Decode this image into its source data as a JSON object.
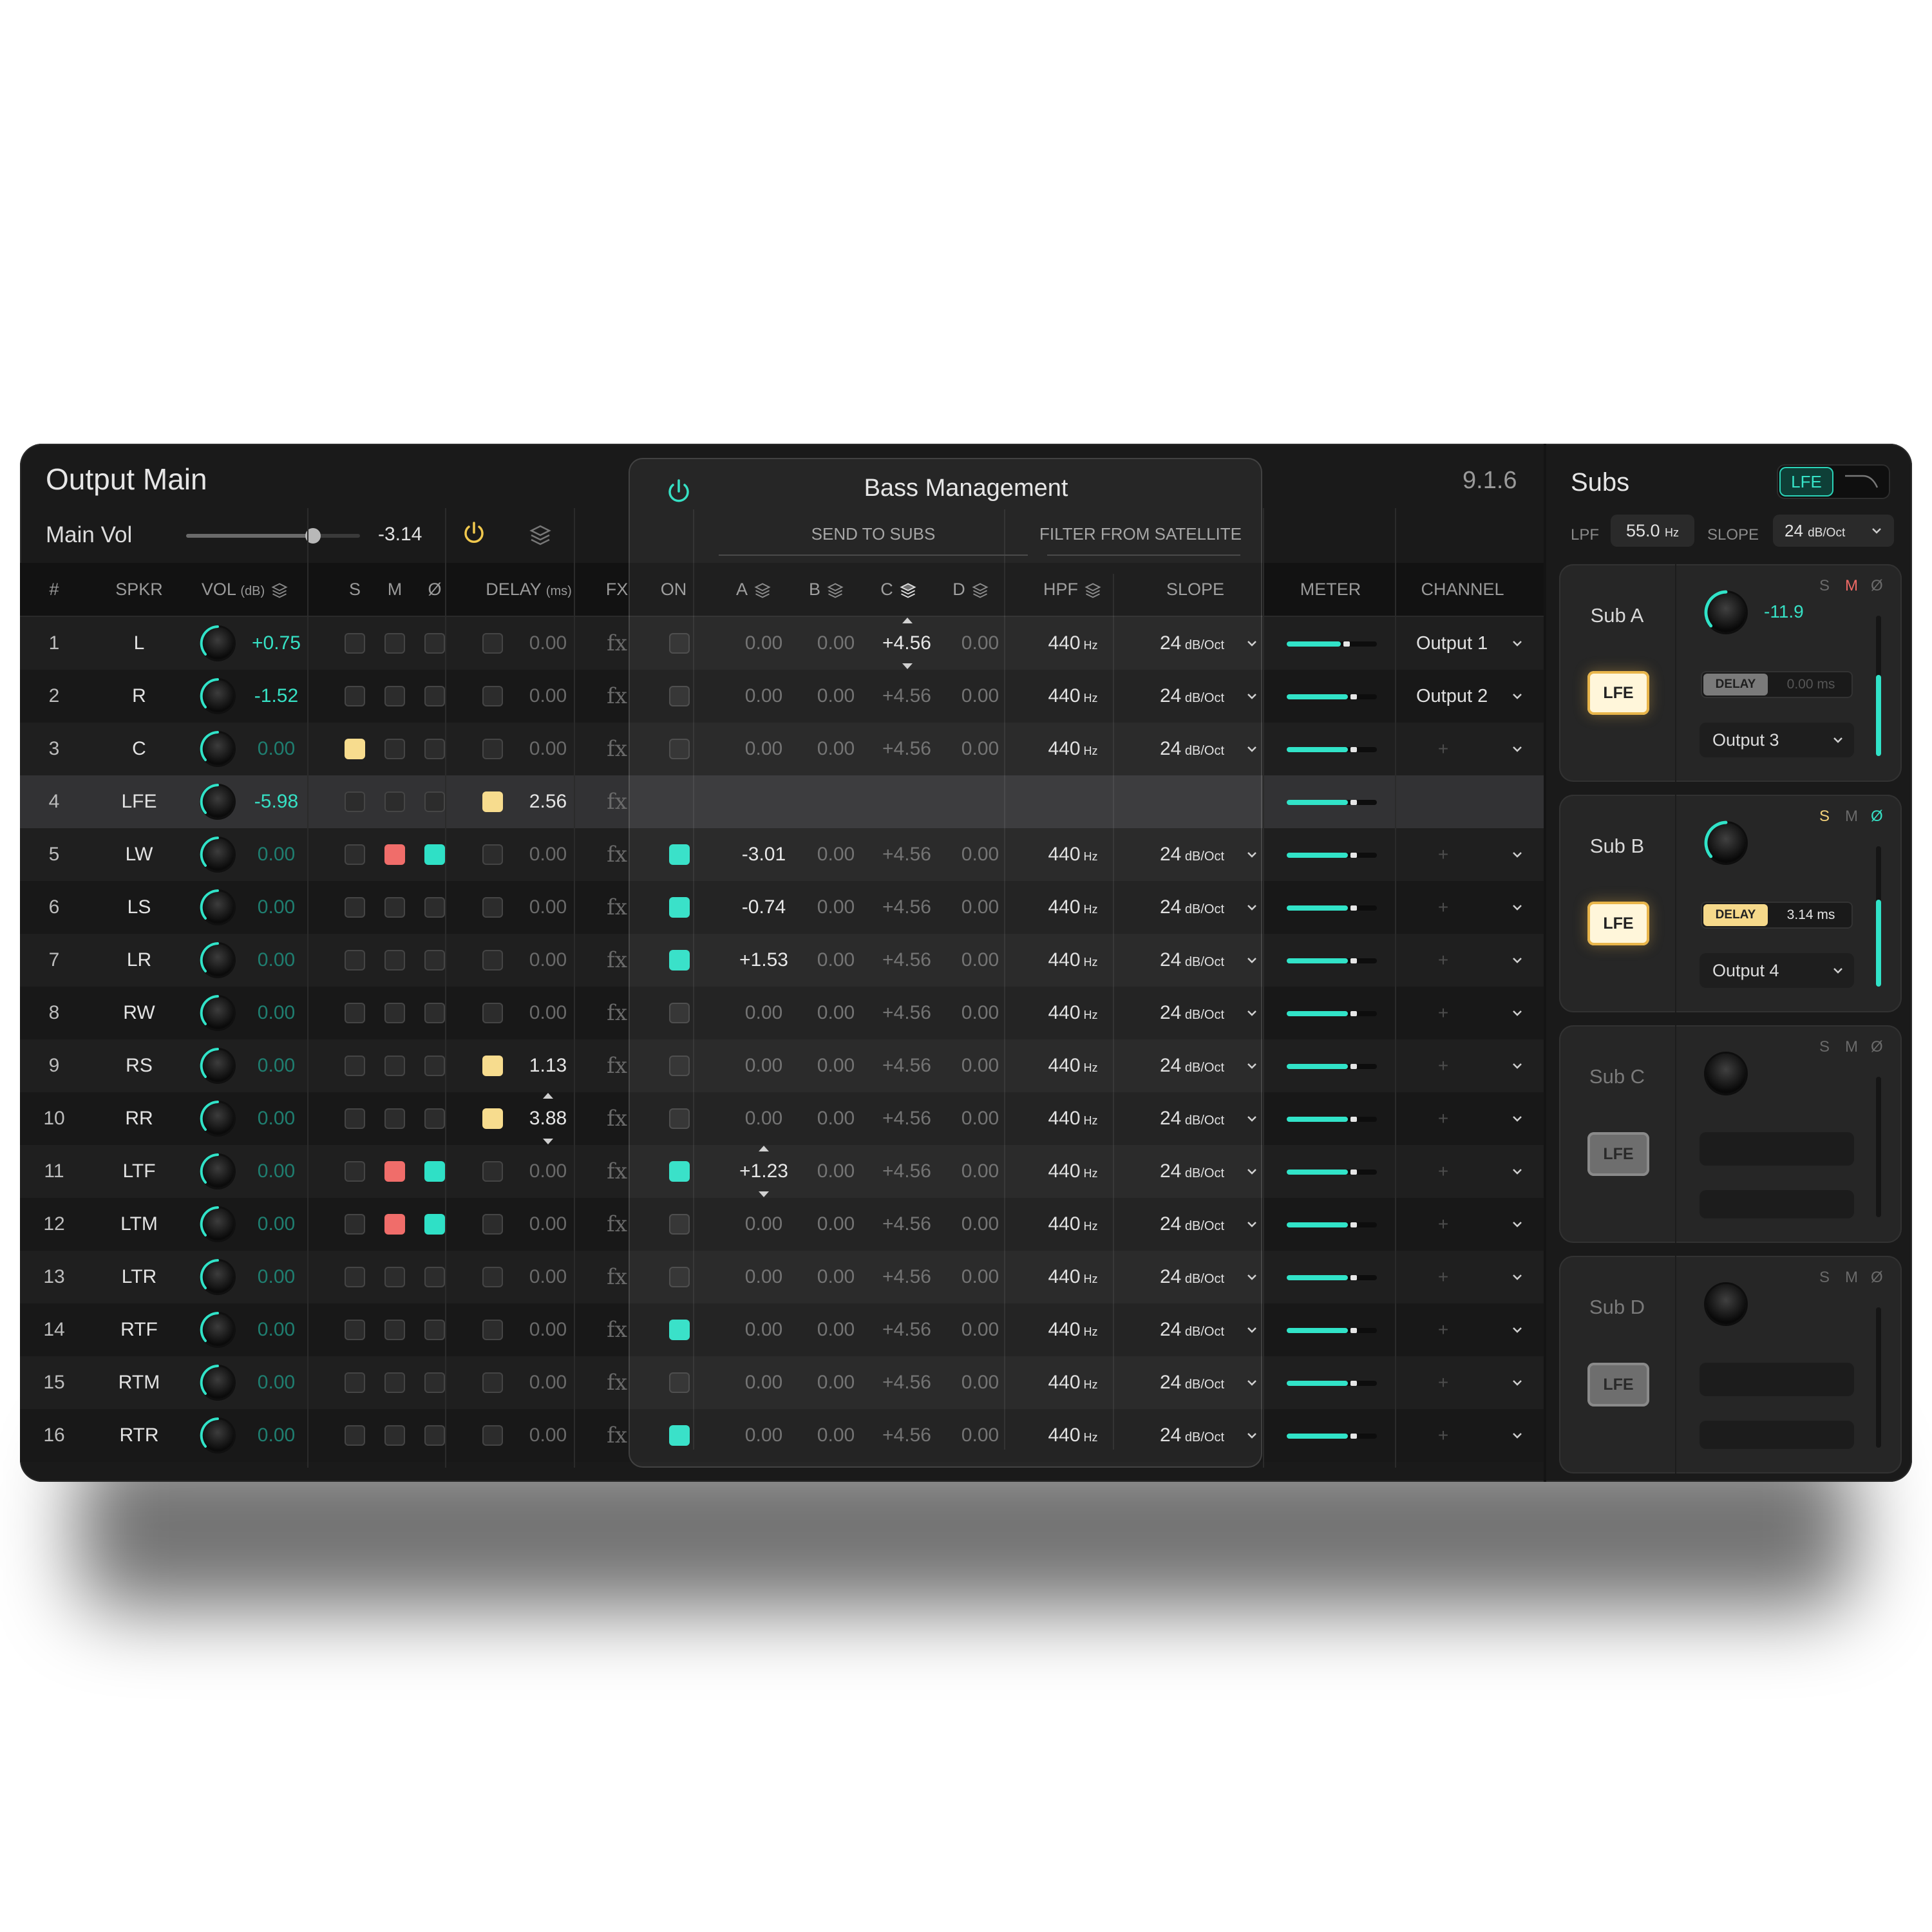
{
  "title": "Output Main",
  "main_vol": {
    "label": "Main Vol",
    "value": "-3.14",
    "slider_level": 0.73
  },
  "format": "9.1.6",
  "headers": {
    "num": "#",
    "spkr": "SPKR",
    "vol": "VOL",
    "vol_unit": "(dB)",
    "s": "S",
    "m": "M",
    "phase": "Ø",
    "delay": "DELAY",
    "delay_unit": "(ms)",
    "fx": "FX",
    "on": "ON",
    "a": "A",
    "b": "B",
    "c": "C",
    "d": "D",
    "hpf": "HPF",
    "slope": "SLOPE",
    "meter": "METER",
    "channel": "CHANNEL"
  },
  "bass_management": {
    "title": "Bass Management",
    "send_to_subs": "SEND TO SUBS",
    "filter_from_satellite": "FILTER FROM SATELLITE"
  },
  "units": {
    "hz": "Hz",
    "db_oct": "dB/Oct"
  },
  "rows": [
    {
      "num": "1",
      "spkr": "L",
      "vol": "+0.75",
      "s": "off",
      "m": "off",
      "p": "off",
      "delay_on": false,
      "delay": "0.00",
      "fx": "fx",
      "on": false,
      "a": "0.00",
      "b": "0.00",
      "c": "+4.56",
      "d": "0.00",
      "hpf": "440",
      "slope": "24",
      "meter": 0.6,
      "channel": "Output 1"
    },
    {
      "num": "2",
      "spkr": "R",
      "vol": "-1.52",
      "s": "off",
      "m": "off",
      "p": "off",
      "delay_on": false,
      "delay": "0.00",
      "fx": "fx",
      "on": false,
      "a": "0.00",
      "b": "0.00",
      "c": "+4.56",
      "d": "0.00",
      "hpf": "440",
      "slope": "24",
      "meter": 0.68,
      "channel": "Output 2"
    },
    {
      "num": "3",
      "spkr": "C",
      "vol": "0.00",
      "s": "yellow",
      "m": "off",
      "p": "off",
      "delay_on": false,
      "delay": "0.00",
      "fx": "fx",
      "on": false,
      "a": "0.00",
      "b": "0.00",
      "c": "+4.56",
      "d": "0.00",
      "hpf": "440",
      "slope": "24",
      "meter": 0.68,
      "channel": "+"
    },
    {
      "num": "4",
      "spkr": "LFE",
      "vol": "-5.98",
      "s": "off",
      "m": "off",
      "p": "off",
      "delay_on": true,
      "delay": "2.56",
      "fx": "fx",
      "lfe": true,
      "meter": 0.68
    },
    {
      "num": "5",
      "spkr": "LW",
      "vol": "0.00",
      "s": "off",
      "m": "red",
      "p": "teal",
      "delay_on": false,
      "delay": "0.00",
      "fx": "fx",
      "on": true,
      "a": "-3.01",
      "b": "0.00",
      "c": "+4.56",
      "d": "0.00",
      "hpf": "440",
      "slope": "24",
      "meter": 0.68,
      "channel": "+"
    },
    {
      "num": "6",
      "spkr": "LS",
      "vol": "0.00",
      "s": "off",
      "m": "off",
      "p": "off",
      "delay_on": false,
      "delay": "0.00",
      "fx": "fx",
      "on": true,
      "a": "-0.74",
      "b": "0.00",
      "c": "+4.56",
      "d": "0.00",
      "hpf": "440",
      "slope": "24",
      "meter": 0.68,
      "channel": "+"
    },
    {
      "num": "7",
      "spkr": "LR",
      "vol": "0.00",
      "s": "off",
      "m": "off",
      "p": "off",
      "delay_on": false,
      "delay": "0.00",
      "fx": "fx",
      "on": true,
      "a": "+1.53",
      "b": "0.00",
      "c": "+4.56",
      "d": "0.00",
      "hpf": "440",
      "slope": "24",
      "meter": 0.68,
      "channel": "+"
    },
    {
      "num": "8",
      "spkr": "RW",
      "vol": "0.00",
      "s": "off",
      "m": "off",
      "p": "off",
      "delay_on": false,
      "delay": "0.00",
      "fx": "fx",
      "on": false,
      "a": "0.00",
      "b": "0.00",
      "c": "+4.56",
      "d": "0.00",
      "hpf": "440",
      "slope": "24",
      "meter": 0.68,
      "channel": "+"
    },
    {
      "num": "9",
      "spkr": "RS",
      "vol": "0.00",
      "s": "off",
      "m": "off",
      "p": "off",
      "delay_on": true,
      "delay": "1.13",
      "fx": "fx",
      "on": false,
      "a": "0.00",
      "b": "0.00",
      "c": "+4.56",
      "d": "0.00",
      "hpf": "440",
      "slope": "24",
      "meter": 0.68,
      "channel": "+"
    },
    {
      "num": "10",
      "spkr": "RR",
      "vol": "0.00",
      "s": "off",
      "m": "off",
      "p": "off",
      "delay_on": true,
      "delay": "3.88",
      "fx": "fx",
      "on": false,
      "a": "0.00",
      "b": "0.00",
      "c": "+4.56",
      "d": "0.00",
      "hpf": "440",
      "slope": "24",
      "meter": 0.68,
      "channel": "+"
    },
    {
      "num": "11",
      "spkr": "LTF",
      "vol": "0.00",
      "s": "off",
      "m": "red",
      "p": "teal",
      "delay_on": false,
      "delay": "0.00",
      "fx": "fx",
      "on": true,
      "a": "+1.23",
      "b": "0.00",
      "c": "+4.56",
      "d": "0.00",
      "hpf": "440",
      "slope": "24",
      "meter": 0.68,
      "channel": "+"
    },
    {
      "num": "12",
      "spkr": "LTM",
      "vol": "0.00",
      "s": "off",
      "m": "red",
      "p": "teal",
      "delay_on": false,
      "delay": "0.00",
      "fx": "fx",
      "on": false,
      "a": "0.00",
      "b": "0.00",
      "c": "+4.56",
      "d": "0.00",
      "hpf": "440",
      "slope": "24",
      "meter": 0.68,
      "channel": "+"
    },
    {
      "num": "13",
      "spkr": "LTR",
      "vol": "0.00",
      "s": "off",
      "m": "off",
      "p": "off",
      "delay_on": false,
      "delay": "0.00",
      "fx": "fx",
      "on": false,
      "a": "0.00",
      "b": "0.00",
      "c": "+4.56",
      "d": "0.00",
      "hpf": "440",
      "slope": "24",
      "meter": 0.68,
      "channel": "+"
    },
    {
      "num": "14",
      "spkr": "RTF",
      "vol": "0.00",
      "s": "off",
      "m": "off",
      "p": "off",
      "delay_on": false,
      "delay": "0.00",
      "fx": "fx",
      "on": true,
      "a": "0.00",
      "b": "0.00",
      "c": "+4.56",
      "d": "0.00",
      "hpf": "440",
      "slope": "24",
      "meter": 0.68,
      "channel": "+"
    },
    {
      "num": "15",
      "spkr": "RTM",
      "vol": "0.00",
      "s": "off",
      "m": "off",
      "p": "off",
      "delay_on": false,
      "delay": "0.00",
      "fx": "fx",
      "on": false,
      "a": "0.00",
      "b": "0.00",
      "c": "+4.56",
      "d": "0.00",
      "hpf": "440",
      "slope": "24",
      "meter": 0.68,
      "channel": "+"
    },
    {
      "num": "16",
      "spkr": "RTR",
      "vol": "0.00",
      "s": "off",
      "m": "off",
      "p": "off",
      "delay_on": false,
      "delay": "0.00",
      "fx": "fx",
      "on": true,
      "a": "0.00",
      "b": "0.00",
      "c": "+4.56",
      "d": "0.00",
      "hpf": "440",
      "slope": "24",
      "meter": 0.68,
      "channel": "+"
    }
  ],
  "subs": {
    "title": "Subs",
    "lfe_toggle": "LFE",
    "lpf_label": "LPF",
    "lpf_value": "55.0",
    "slope_label": "SLOPE",
    "slope_value": "24",
    "cards": [
      {
        "name": "Sub A",
        "lfe": "LFE",
        "lfe_on": true,
        "s": "S",
        "m": "M",
        "p": "Ø",
        "active": "m",
        "gain": "-11.9",
        "delay_label": "DELAY",
        "delay_on": false,
        "delay_value": "0.00 ms",
        "output": "Output 3",
        "meter": 0.58
      },
      {
        "name": "Sub B",
        "lfe": "LFE",
        "lfe_on": true,
        "s": "S",
        "m": "M",
        "p": "Ø",
        "active": "sp",
        "gain": "",
        "delay_label": "DELAY",
        "delay_on": true,
        "delay_value": "3.14 ms",
        "output": "Output 4",
        "meter": 0.62
      },
      {
        "name": "Sub C",
        "lfe": "LFE",
        "lfe_on": false,
        "s": "S",
        "m": "M",
        "p": "Ø",
        "active": "",
        "gain": "",
        "meter": 0
      },
      {
        "name": "Sub D",
        "lfe": "LFE",
        "lfe_on": false,
        "s": "S",
        "m": "M",
        "p": "Ø",
        "active": "",
        "gain": "",
        "meter": 0
      }
    ]
  },
  "colors": {
    "accent": "#31e3c8",
    "mute": "#f06d6a",
    "solo": "#f7dc8e",
    "lfe_glow": "#e8b54a"
  },
  "icons": {
    "power": "power-icon",
    "layers": "layers-icon",
    "chevron": "chevron-down-icon",
    "curve": "lowpass-curve-icon"
  }
}
